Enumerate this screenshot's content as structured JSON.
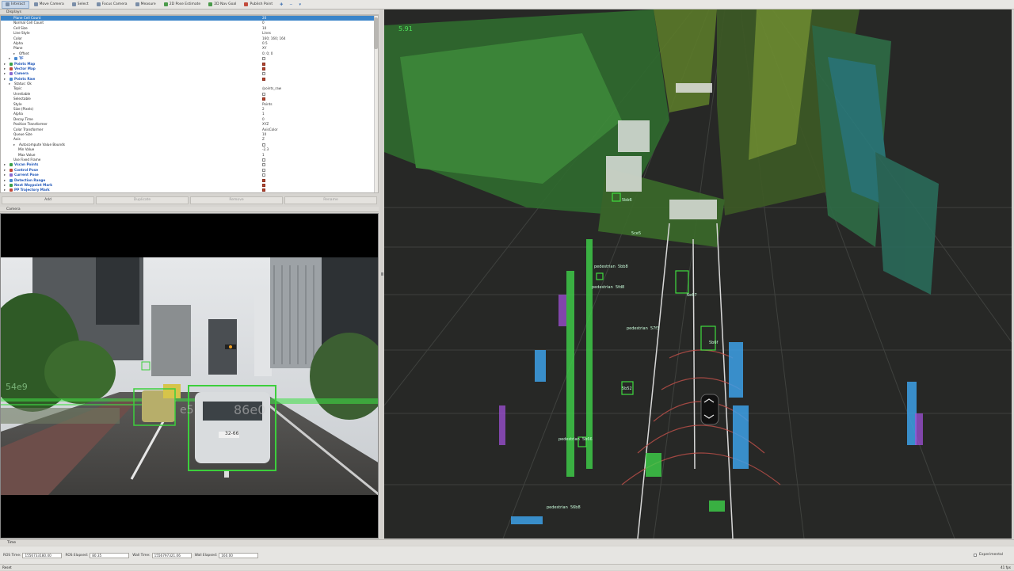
{
  "toolbar": {
    "interact": "Interact",
    "move_camera": "Move Camera",
    "select": "Select",
    "focus_camera": "Focus Camera",
    "measure": "Measure",
    "pose_estimate": "2D Pose Estimate",
    "nav_goal": "2D Nav Goal",
    "publish_point": "Publish Point"
  },
  "displays": {
    "title": "Displays",
    "rows": [
      {
        "k": "Plane Cell Count",
        "v": "20",
        "indent": 2,
        "sel": true
      },
      {
        "k": "Normal Cell Count",
        "v": "0",
        "indent": 2
      },
      {
        "k": "Cell Size",
        "v": "10",
        "indent": 2
      },
      {
        "k": "Line Style",
        "v": "Lines",
        "indent": 2
      },
      {
        "k": "Color",
        "v": "160; 160; 164",
        "indent": 2
      },
      {
        "k": "Alpha",
        "v": "0.5",
        "indent": 2
      },
      {
        "k": "Plane",
        "v": "XY",
        "indent": 2
      },
      {
        "k": "Offset",
        "v": "0; 0; 0",
        "indent": 2,
        "arrow": true
      },
      {
        "k": "TF",
        "v": "",
        "indent": 1,
        "arrow": true,
        "cb": "off",
        "blue": true
      },
      {
        "k": "Points Map",
        "v": "",
        "indent": 0,
        "arrow": true,
        "cb": "on",
        "blue": true
      },
      {
        "k": "Vector Map",
        "v": "",
        "indent": 0,
        "arrow": true,
        "cb": "on",
        "blue": true
      },
      {
        "k": "Camera",
        "v": "",
        "indent": 0,
        "arrow": true,
        "cb": "off",
        "blue": true
      },
      {
        "k": "Points Raw",
        "v": "",
        "indent": 0,
        "arrow": true,
        "cb": "on",
        "blue": true
      },
      {
        "k": "Status: Ok",
        "v": "",
        "indent": 1,
        "arrow": true
      },
      {
        "k": "Topic",
        "v": "/points_raw",
        "indent": 2
      },
      {
        "k": "Unreliable",
        "v": "",
        "indent": 2,
        "cb": "off"
      },
      {
        "k": "Selectable",
        "v": "",
        "indent": 2,
        "cb": "on"
      },
      {
        "k": "Style",
        "v": "Points",
        "indent": 2
      },
      {
        "k": "Size (Pixels)",
        "v": "2",
        "indent": 2
      },
      {
        "k": "Alpha",
        "v": "1",
        "indent": 2
      },
      {
        "k": "Decay Time",
        "v": "0",
        "indent": 2
      },
      {
        "k": "Position Transformer",
        "v": "XYZ",
        "indent": 2
      },
      {
        "k": "Color Transformer",
        "v": "AxisColor",
        "indent": 2
      },
      {
        "k": "Queue Size",
        "v": "10",
        "indent": 2
      },
      {
        "k": "Axis",
        "v": "Z",
        "indent": 2
      },
      {
        "k": "Autocompute Value Bounds",
        "v": "",
        "indent": 2,
        "arrow": true,
        "cb": "off"
      },
      {
        "k": "Min Value",
        "v": "-2.3",
        "indent": 3
      },
      {
        "k": "Max Value",
        "v": "1",
        "indent": 3
      },
      {
        "k": "Use Fixed Frame",
        "v": "",
        "indent": 2,
        "cb": "off"
      },
      {
        "k": "Vscan Points",
        "v": "",
        "indent": 0,
        "arrow": true,
        "cb": "off",
        "blue": true
      },
      {
        "k": "Control Pose",
        "v": "",
        "indent": 0,
        "arrow": true,
        "cb": "off",
        "blue": true
      },
      {
        "k": "Current Pose",
        "v": "",
        "indent": 0,
        "arrow": true,
        "cb": "off",
        "blue": true
      },
      {
        "k": "Detection Range",
        "v": "",
        "indent": 0,
        "arrow": true,
        "cb": "on",
        "blue": true
      },
      {
        "k": "Next Waypoint Mark",
        "v": "",
        "indent": 0,
        "arrow": true,
        "cb": "on",
        "blue": true
      },
      {
        "k": "PP Trajectory Mark",
        "v": "",
        "indent": 0,
        "arrow": true,
        "cb": "on",
        "blue": true
      }
    ],
    "buttons": {
      "add": "Add",
      "duplicate": "Duplicate",
      "remove": "Remove",
      "rename": "Rename"
    }
  },
  "camera": {
    "title": "Camera",
    "overlay_a": "54e9",
    "overlay_b": "e5",
    "overlay_c": "86e0",
    "plate": "32-66"
  },
  "view3d": {
    "speed": "5.91",
    "labels": {
      "pedestrian": "pedestrian",
      "n1": "5bb8",
      "n2": "5fd8",
      "n3": "57f3",
      "n4": "5b52",
      "n5": "5b6f",
      "n6": "5b66",
      "n7": "56b8",
      "n8": "5ce5",
      "n9": "5bb6",
      "n10": "6e67"
    }
  },
  "time": {
    "title": "Time",
    "ros_time_label": "ROS Time:",
    "ros_time": "1556733180.40",
    "ros_elapsed_label": "ROS Elapsed:",
    "ros_elapsed": "80.35",
    "wall_time_label": "Wall Time:",
    "wall_time": "1556797321.06",
    "wall_elapsed_label": "Wall Elapsed:",
    "wall_elapsed": "160.00",
    "experimental": "Experimental"
  },
  "status": {
    "reset": "Reset",
    "fps": "41 fps"
  }
}
